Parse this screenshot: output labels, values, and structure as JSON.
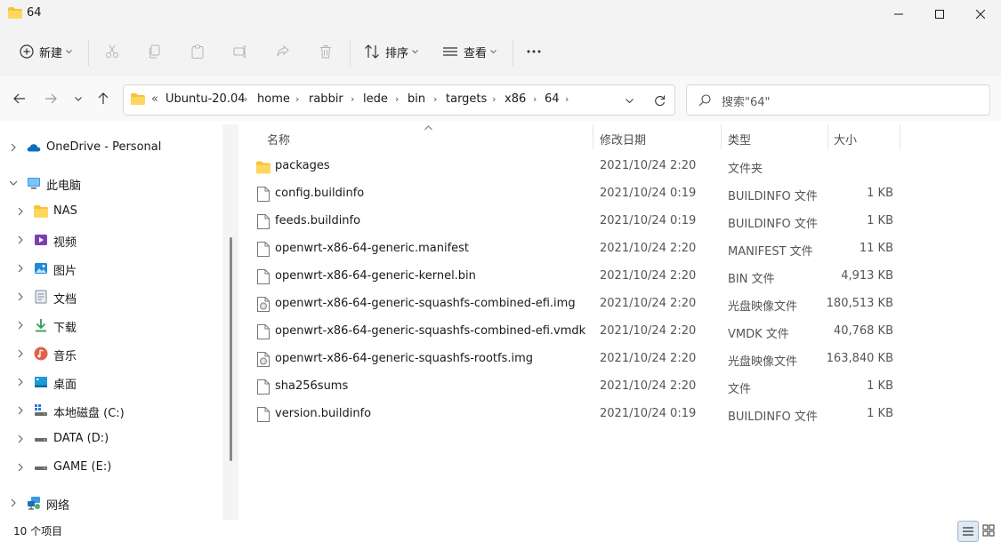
{
  "window": {
    "title": "64",
    "controls": [
      "minimize-icon",
      "maximize-icon",
      "close-icon"
    ]
  },
  "toolbar": {
    "new_label": "新建",
    "sort_label": "排序",
    "view_label": "查看",
    "icons": [
      "plus-icon",
      "cut-icon",
      "copy-icon",
      "paste-icon",
      "rename-icon",
      "share-icon",
      "delete-icon",
      "sort-icon",
      "view-icon",
      "more-icon"
    ]
  },
  "address": {
    "overflow": "«",
    "crumbs": [
      "Ubuntu-20.04",
      "home",
      "rabbir",
      "lede",
      "bin",
      "targets",
      "x86",
      "64"
    ]
  },
  "search": {
    "placeholder": "搜索\"64\""
  },
  "sidebar": {
    "items": [
      {
        "label": "OneDrive - Personal",
        "icon": "cloud-icon"
      },
      {
        "label": "此电脑",
        "icon": "computer-icon"
      },
      {
        "label": "NAS",
        "icon": "folder-icon"
      },
      {
        "label": "视频",
        "icon": "video-icon"
      },
      {
        "label": "图片",
        "icon": "pictures-icon"
      },
      {
        "label": "文档",
        "icon": "document-icon"
      },
      {
        "label": "下载",
        "icon": "download-icon"
      },
      {
        "label": "音乐",
        "icon": "music-icon"
      },
      {
        "label": "桌面",
        "icon": "desktop-icon"
      },
      {
        "label": "本地磁盘 (C:)",
        "icon": "windows-drive-icon"
      },
      {
        "label": "DATA (D:)",
        "icon": "drive-icon"
      },
      {
        "label": "GAME (E:)",
        "icon": "drive-icon"
      },
      {
        "label": "网络",
        "icon": "network-icon"
      }
    ]
  },
  "columns": {
    "name": "名称",
    "date": "修改日期",
    "type": "类型",
    "size": "大小"
  },
  "files": [
    {
      "name": "packages",
      "date": "2021/10/24 2:20",
      "type": "文件夹",
      "size": "",
      "icon": "folder-icon"
    },
    {
      "name": "config.buildinfo",
      "date": "2021/10/24 0:19",
      "type": "BUILDINFO 文件",
      "size": "1 KB",
      "icon": "file-icon"
    },
    {
      "name": "feeds.buildinfo",
      "date": "2021/10/24 0:19",
      "type": "BUILDINFO 文件",
      "size": "1 KB",
      "icon": "file-icon"
    },
    {
      "name": "openwrt-x86-64-generic.manifest",
      "date": "2021/10/24 2:20",
      "type": "MANIFEST 文件",
      "size": "11 KB",
      "icon": "file-icon"
    },
    {
      "name": "openwrt-x86-64-generic-kernel.bin",
      "date": "2021/10/24 2:20",
      "type": "BIN 文件",
      "size": "4,913 KB",
      "icon": "file-icon"
    },
    {
      "name": "openwrt-x86-64-generic-squashfs-combined-efi.img",
      "date": "2021/10/24 2:20",
      "type": "光盘映像文件",
      "size": "180,513 KB",
      "icon": "disc-image-icon"
    },
    {
      "name": "openwrt-x86-64-generic-squashfs-combined-efi.vmdk",
      "date": "2021/10/24 2:20",
      "type": "VMDK 文件",
      "size": "40,768 KB",
      "icon": "file-icon"
    },
    {
      "name": "openwrt-x86-64-generic-squashfs-rootfs.img",
      "date": "2021/10/24 2:20",
      "type": "光盘映像文件",
      "size": "163,840 KB",
      "icon": "disc-image-icon"
    },
    {
      "name": "sha256sums",
      "date": "2021/10/24 2:20",
      "type": "文件",
      "size": "1 KB",
      "icon": "file-icon"
    },
    {
      "name": "version.buildinfo",
      "date": "2021/10/24 0:19",
      "type": "BUILDINFO 文件",
      "size": "1 KB",
      "icon": "file-icon"
    }
  ],
  "status": {
    "count": "10 个项目"
  },
  "colors": {
    "accent": "#0067c0",
    "folder": "#f4c33d",
    "chrome": "#f3f3f3"
  }
}
